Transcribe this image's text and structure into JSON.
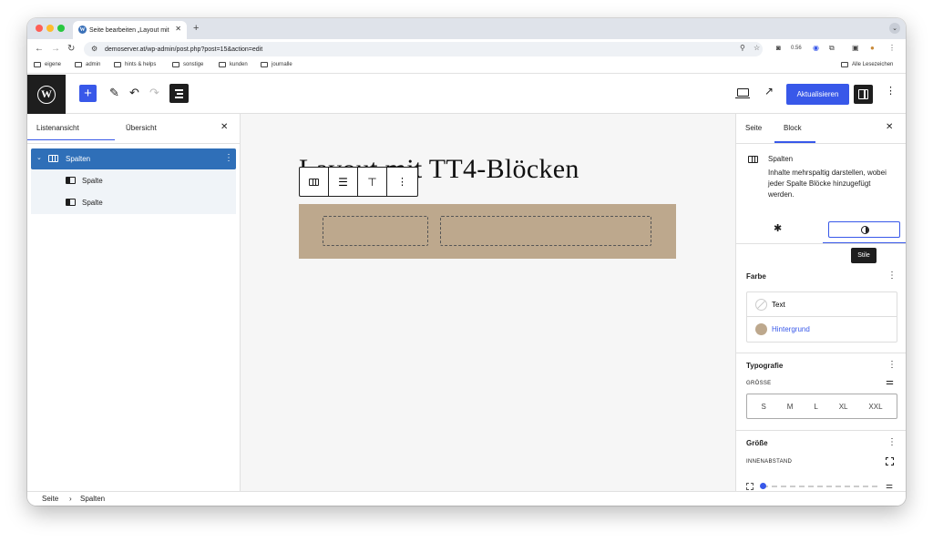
{
  "browser": {
    "tab_title": "Seite bearbeiten „Layout mit",
    "new_tab_symbol": "+",
    "url": "demoserver.at/wp-admin/post.php?post=15&action=edit",
    "bookmarks": [
      "eigene",
      "admin",
      "hints & helps",
      "sonstige",
      "kunden",
      "journalle"
    ],
    "all_bookmarks": "Alle Lesezeichen",
    "extension_badge": "0.56"
  },
  "wp_toolbar": {
    "update_label": "Aktualisieren"
  },
  "list_view": {
    "tab_list": "Listenansicht",
    "tab_overview": "Übersicht",
    "items": [
      {
        "label": "Spalten"
      },
      {
        "label": "Spalte"
      },
      {
        "label": "Spalte"
      }
    ]
  },
  "canvas": {
    "page_title": "Layout mit TT4-Blöcken",
    "column_block_color": "#bda88d"
  },
  "sidebar": {
    "tab_page": "Seite",
    "tab_block": "Block",
    "block_name": "Spalten",
    "block_description": "Inhalte mehrspaltig darstellen, wobei jeder Spalte Blöcke hinzugefügt werden.",
    "tooltip": "Stile",
    "color_section": "Farbe",
    "color_items": [
      {
        "label": "Text",
        "color": ""
      },
      {
        "label": "Hintergrund",
        "color": "#bda88d"
      }
    ],
    "typography_section": "Typografie",
    "size_label": "GRÖSSE",
    "size_options": [
      "S",
      "M",
      "L",
      "XL",
      "XXL"
    ],
    "dimensions_section": "Größe",
    "padding_label": "INNENABSTAND"
  },
  "footer": {
    "crumb_1": "Seite",
    "separator": "›",
    "crumb_2": "Spalten"
  },
  "colors": {
    "accent": "#3858e9",
    "list_selected": "#2f6fb8",
    "wp_dark": "#1e1e1e"
  }
}
